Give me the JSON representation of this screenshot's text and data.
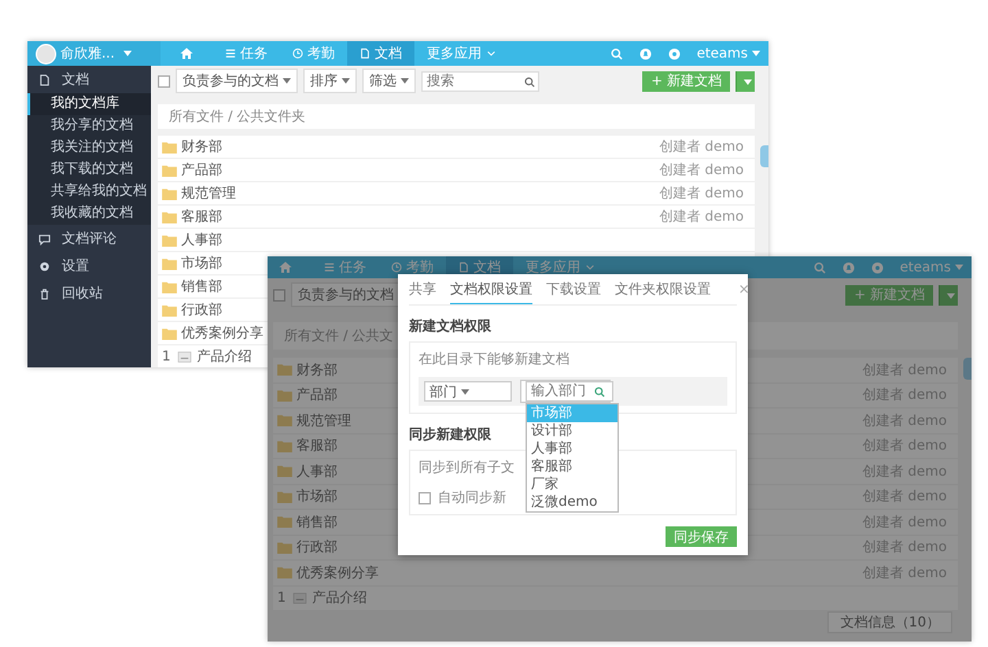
{
  "back_window": {
    "user": "俞欣雅...",
    "nav": [
      {
        "label": "任务",
        "selected": false
      },
      {
        "label": "考勤",
        "selected": false
      },
      {
        "label": "文档",
        "selected": true
      },
      {
        "label": "更多应用",
        "selected": false
      }
    ],
    "brand": "eteams",
    "sidebar": [
      {
        "label": "文档",
        "children": [
          {
            "label": "我的文档库",
            "selected": true
          },
          {
            "label": "我分享的文档",
            "selected": false
          },
          {
            "label": "我关注的文档",
            "selected": false
          },
          {
            "label": "我下载的文档",
            "selected": false
          },
          {
            "label": "共享给我的文档",
            "selected": false
          },
          {
            "label": "我收藏的文档",
            "selected": false
          }
        ]
      },
      {
        "label": "文档评论"
      },
      {
        "label": "设置"
      },
      {
        "label": "回收站"
      }
    ],
    "toolbar": {
      "checked": false,
      "filter": "负责参与的文档",
      "sort": "排序",
      "screen": "筛选",
      "search_placeholder": "搜索",
      "new_button": "+ 新建文档"
    },
    "breadcrumb": "所有文件 / 公共文件夹",
    "rows": [
      {
        "kind": "folder",
        "name": "财务部",
        "owner": "创建者 demo"
      },
      {
        "kind": "folder",
        "name": "产品部",
        "owner": "创建者 demo"
      },
      {
        "kind": "folder",
        "name": "规范管理",
        "owner": "创建者 demo"
      },
      {
        "kind": "folder",
        "name": "客服部",
        "owner": "创建者 demo"
      },
      {
        "kind": "folder",
        "name": "人事部"
      },
      {
        "kind": "folder",
        "name": "市场部"
      },
      {
        "kind": "folder",
        "name": "销售部"
      },
      {
        "kind": "folder",
        "name": "行政部"
      },
      {
        "kind": "folder",
        "name": "优秀案例分享"
      },
      {
        "kind": "file",
        "index": "1",
        "name": "产品介绍"
      }
    ]
  },
  "front_window": {
    "nav": [
      {
        "label": "任务",
        "selected": false
      },
      {
        "label": "考勤",
        "selected": false
      },
      {
        "label": "文档",
        "selected": true
      },
      {
        "label": "更多应用",
        "selected": false
      }
    ],
    "brand": "eteams",
    "toolbar": {
      "checked": false,
      "filter": "负责参与的文档",
      "new_button": "+ 新建文档"
    },
    "breadcrumb": "所有文件 / 公共文",
    "rows": [
      {
        "kind": "folder",
        "name": "财务部",
        "owner": "创建者 demo"
      },
      {
        "kind": "folder",
        "name": "产品部",
        "owner": "创建者 demo"
      },
      {
        "kind": "folder",
        "name": "规范管理",
        "owner": "创建者 demo"
      },
      {
        "kind": "folder",
        "name": "客服部",
        "owner": "创建者 demo"
      },
      {
        "kind": "folder",
        "name": "人事部",
        "owner": "创建者 demo"
      },
      {
        "kind": "folder",
        "name": "市场部",
        "owner": "创建者 demo"
      },
      {
        "kind": "folder",
        "name": "销售部",
        "owner": "创建者 demo"
      },
      {
        "kind": "folder",
        "name": "行政部",
        "owner": "创建者 demo"
      },
      {
        "kind": "folder",
        "name": "优秀案例分享",
        "owner": "创建者 demo"
      },
      {
        "kind": "file",
        "index": "1",
        "name": "产品介绍"
      }
    ],
    "info_tab": "文档信息（10）",
    "dialog": {
      "tabs": [
        {
          "label": "共享",
          "selected": false
        },
        {
          "label": "文档权限设置",
          "selected": true
        },
        {
          "label": "下载设置",
          "selected": false
        },
        {
          "label": "文件夹权限设置",
          "selected": false
        }
      ],
      "close": "×",
      "new_section": {
        "title": "新建文档权限",
        "hint": "在此目录下能够新建文档",
        "select": "部门",
        "placeholder": "输入部门",
        "options": [
          {
            "label": "市场部",
            "selected": true
          },
          {
            "label": "设计部",
            "selected": false
          },
          {
            "label": "人事部",
            "selected": false
          },
          {
            "label": "客服部",
            "selected": false
          },
          {
            "label": "厂家",
            "selected": false
          },
          {
            "label": "泛微demo",
            "selected": false
          }
        ]
      },
      "sync_section": {
        "title": "同步新建权限",
        "hint": "同步到所有子文",
        "checkbox_label": "自动同步新",
        "checked": false
      },
      "save_button": "同步保存"
    }
  }
}
